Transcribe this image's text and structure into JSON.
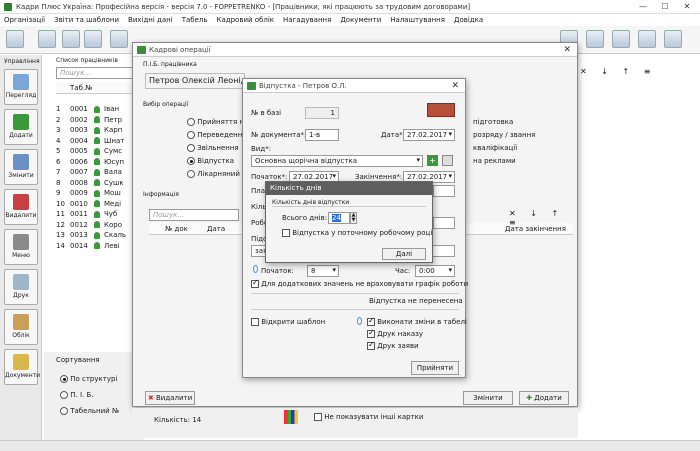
{
  "app": {
    "title": "Кадри Плюс Україна: Професійна версія - версія 7.0 - FOPPETRENKO - [Працівники, які працюють за трудовим договорами]"
  },
  "menu": [
    "Організації",
    "Звіти та шаблони",
    "Вихідні дані",
    "Табель",
    "Кадровий облік",
    "Нагадування",
    "Документи",
    "Налаштування",
    "Довідка"
  ],
  "left_nav": [
    {
      "label": "Управління"
    },
    {
      "label": "Перегляд"
    },
    {
      "label": "Додати"
    },
    {
      "label": "Змінити"
    },
    {
      "label": "Видалити"
    },
    {
      "label": "Меню"
    },
    {
      "label": "Друк"
    },
    {
      "label": "Облік"
    },
    {
      "label": "Документи"
    }
  ],
  "employees": {
    "header": "Список працівників",
    "search_placeholder": "Пошук...",
    "col_tab": "Таб.№",
    "rows": [
      {
        "n": "1",
        "tab": "0001",
        "name": "Іван"
      },
      {
        "n": "2",
        "tab": "0002",
        "name": "Петр"
      },
      {
        "n": "3",
        "tab": "0003",
        "name": "Карп"
      },
      {
        "n": "4",
        "tab": "0004",
        "name": "Шнат"
      },
      {
        "n": "5",
        "tab": "0005",
        "name": "Сумс"
      },
      {
        "n": "6",
        "tab": "0006",
        "name": "Юсуп"
      },
      {
        "n": "7",
        "tab": "0007",
        "name": "Вала"
      },
      {
        "n": "8",
        "tab": "0008",
        "name": "Сушк"
      },
      {
        "n": "9",
        "tab": "0009",
        "name": "Мош"
      },
      {
        "n": "10",
        "tab": "0010",
        "name": "Меді"
      },
      {
        "n": "11",
        "tab": "0011",
        "name": "Чуб"
      },
      {
        "n": "12",
        "tab": "0012",
        "name": "Коро"
      },
      {
        "n": "13",
        "tab": "0013",
        "name": "Скаль"
      },
      {
        "n": "14",
        "tab": "0014",
        "name": "Леві"
      }
    ]
  },
  "sorting": {
    "header": "Сортування",
    "options": [
      "По структурі",
      "П. І. Б.",
      "Табельний №"
    ]
  },
  "kadrovi": {
    "title": "Кадрові операції",
    "pib_label": "П.І.Б. працівника",
    "pib_value": "Петров Олексій Леонідович",
    "ops_label": "Вибір операції",
    "ops": [
      "Прийняття на",
      "Переведення",
      "Звільнення",
      "Відпустка",
      "Лікарняний"
    ],
    "right_texts": [
      "підготовка",
      "розряду / звання",
      "кваліфікації",
      "на реклами"
    ],
    "info_label": "Інформація",
    "info_search": "Пошук...",
    "col_doc": "№ док",
    "col_date": "Дата",
    "col_end": "Дата закінчення",
    "btn_delete": "Видалити",
    "btn_change": "Змінити",
    "btn_add": "Додати",
    "count": "Кількість: 14",
    "no_show": "Не показувати інші картки"
  },
  "vidpustka": {
    "title": "Відпустка - Петров О.Л.",
    "nbase_label": "№ в базі",
    "nbase_value": "1",
    "ndoc_label": "№ документа*:",
    "ndoc_value": "1-в",
    "date_label": "Дата*:",
    "date_value": "27.02.2017",
    "vid_label": "Вид*:",
    "vid_value": "Основна щорічна відпустка",
    "start_label": "Початок*:",
    "start_value": "27.02.2017",
    "end_label": "Закінчення*:",
    "end_value": "27.02.2017",
    "plan_label": "План",
    "kilk_label": "Кільк",
    "robot_label": "Робот",
    "pidst_label": "Підст",
    "zayav_value": "заяв",
    "pochatok_label": "Початок:",
    "pochatok_value": "8",
    "chas_label": "Час:",
    "chas_value": "0:00",
    "dodat_label": "Для додаткових значень не враховувати графік роботи",
    "not_transferred": "Відпустка не перенесена",
    "open_template": "Відкрити шаблон",
    "exec_changes": "Виконати зміни в табелі",
    "print_order": "Друк наказу",
    "print_statement": "Друк заяви",
    "btn_accept": "Прийняти"
  },
  "kilkist": {
    "title": "Кількість днів",
    "section": "Кількість днів відпустки",
    "total_label": "Всього днів:",
    "total_value": "24",
    "current_year_label": "Відпустка у поточному робочому році",
    "btn_next": "Далі"
  }
}
